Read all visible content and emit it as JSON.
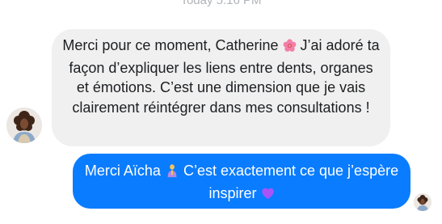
{
  "conversation": {
    "timestamp": "Today 5:16 PM",
    "received": {
      "sender_avatar": "contact-avatar",
      "message_part1": "Merci pour ce moment, Catherine",
      "emoji1": "hibiscus-emoji",
      "message_part2": "J’ai adoré ta façon d’expliquer les liens entre dents, organes et émotions. C’est une dimension que je vais clairement réintégrer dans mes consultations !"
    },
    "sent": {
      "message_part1": "Merci Aïcha",
      "emoji1": "praying-hands-emoji",
      "message_part2": "C’est exactement ce que j’espère inspirer",
      "emoji2": "purple-heart-emoji",
      "read_receipt_avatar": "contact-avatar"
    }
  },
  "colors": {
    "received_bubble": "#f0f0f0",
    "sent_bubble": "#0a7cff",
    "received_text": "#1c1e21",
    "sent_text": "#ffffff",
    "timestamp_text": "#b0b3b8"
  }
}
